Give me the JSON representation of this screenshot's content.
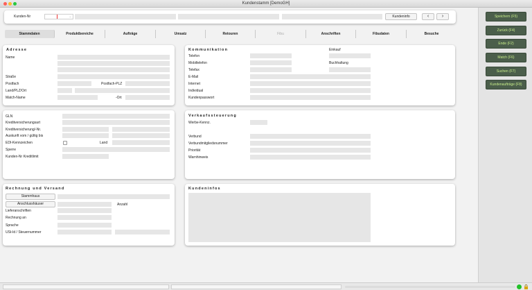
{
  "window": {
    "title": "Kundenstamm [DemoGH]"
  },
  "header": {
    "kunden_nr_label": "Kunden-Nr",
    "kundeninfo_button": "Kundeninfo",
    "prev_icon": "chevron-left-icon",
    "next_icon": "chevron-right-icon"
  },
  "tabs": [
    {
      "label": "Stammdaten",
      "active": true
    },
    {
      "label": "Produktbereiche"
    },
    {
      "label": "Aufträge"
    },
    {
      "label": "Umsatz"
    },
    {
      "label": "Retouren"
    },
    {
      "label": "Fibu",
      "disabled": true
    },
    {
      "label": "Anschriften"
    },
    {
      "label": "Fibudaten"
    },
    {
      "label": "Besuche"
    }
  ],
  "adresse": {
    "title": "Adresse",
    "name": "Name",
    "strasse": "Straße",
    "postfach": "Postfach",
    "postfach_plz": "Postfach-PLZ",
    "land_plz_ort": "Land/PLZ/Ort",
    "match_name": "Match-Name",
    "ort": "-Ort"
  },
  "kommunikation": {
    "title": "Kommunikation",
    "telefon": "Telefon",
    "mobiltelefon": "Mobiltelefon",
    "telefax": "Telefax",
    "email": "E-Mail",
    "internet": "Internet",
    "individual": "Individual",
    "kundenpasswort": "Kundenpasswort",
    "einkauf": "Einkauf",
    "buchhaltung": "Buchhaltung"
  },
  "kredit": {
    "gln": "GLN",
    "kreditversicherungsart": "Kreditversicherungsart",
    "kreditversicherung_nr": "Kreditversicherung/-Nr.",
    "auskunft": "Auskunft vom / gültig bis",
    "edi": "EDI-Kennzeichen",
    "land": "Land",
    "sperre": "Sperre",
    "kundennr_kreditlimit": "Kunden-Nr Kreditlimit"
  },
  "verkauf": {
    "title": "Verkaufssteuerung",
    "werbe": "Werbe-Kennz.",
    "verbund": "Verbund",
    "verbundmitglied": "Verbundmitgliedsnummer",
    "prioritaet": "Priorität",
    "warnhinweis": "Warnhinweis"
  },
  "rechnung": {
    "title": "Rechnung und Versand",
    "stammhaus_button": "Stammhaus",
    "anschlusshaeuser_button": "Anschlusshäuser",
    "anzahl": "Anzahl",
    "lieferanschriften": "Lieferanschriften",
    "rechnung_an": "Rechnung an",
    "sprache": "Sprache",
    "ust": "USt-Id / Steuernummer"
  },
  "kundeninfos": {
    "title": "Kundeninfos"
  },
  "sidebar": {
    "speichern": "Speichern (F5)",
    "zurueck": "Zurück (F4)",
    "ende": "Ende (F2)",
    "match": "Match (F6)",
    "suchen": "Suchen (F7)",
    "kundenauftraege": "Kundenaufträge (F8)"
  },
  "status": {
    "lock_icon": "lock-icon",
    "status_dot_color": "#22c22a"
  }
}
